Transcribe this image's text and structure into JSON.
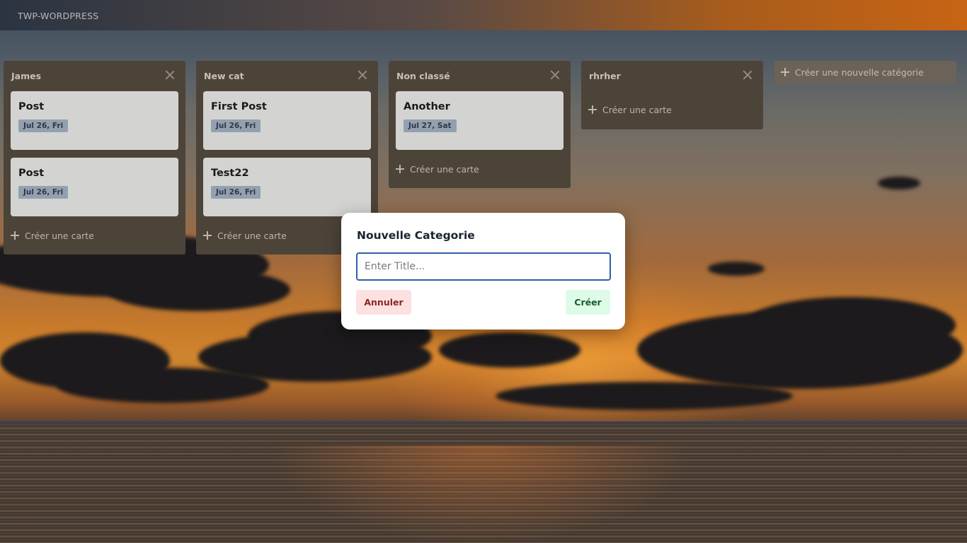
{
  "app": {
    "brand": "TWP-WORDPRESS"
  },
  "columns": [
    {
      "title": "James",
      "cards": [
        {
          "title": "Post",
          "date": "Jul 26, Fri"
        },
        {
          "title": "Post",
          "date": "Jul 26, Fri"
        }
      ],
      "add_label": "Créer une carte"
    },
    {
      "title": "New cat",
      "cards": [
        {
          "title": "First Post",
          "date": "Jul 26, Fri"
        },
        {
          "title": "Test22",
          "date": "Jul 26, Fri"
        }
      ],
      "add_label": "Créer une carte"
    },
    {
      "title": "Non classé",
      "cards": [
        {
          "title": "Another",
          "date": "Jul 27, Sat"
        }
      ],
      "add_label": "Créer une carte"
    },
    {
      "title": "rhrher",
      "cards": [],
      "add_label": "Créer une carte"
    }
  ],
  "new_category_label": "Créer une nouvelle catégorie",
  "modal": {
    "title": "Nouvelle Categorie",
    "input_value": "",
    "input_placeholder": "Enter Title...",
    "cancel_label": "Annuler",
    "create_label": "Créer"
  },
  "colors": {
    "modal_input_border": "#2f5fa8",
    "cancel_bg": "#fde1e1",
    "create_bg": "#ddfbe6"
  }
}
